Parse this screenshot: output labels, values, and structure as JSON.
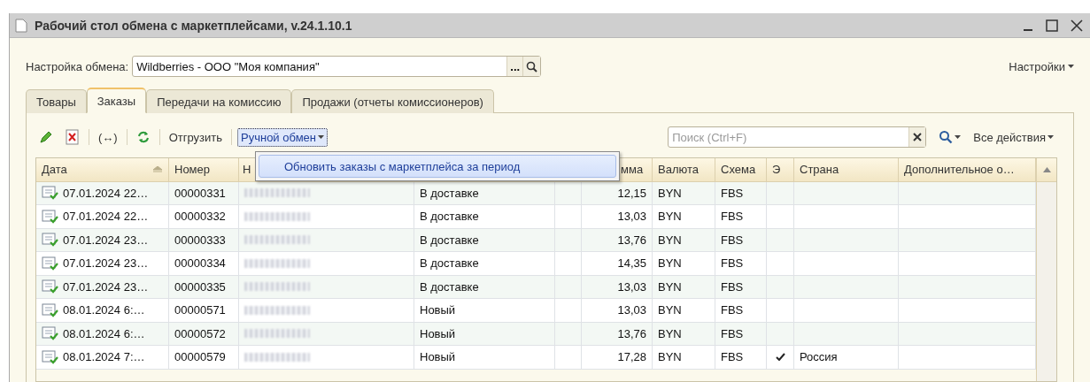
{
  "window": {
    "title": "Рабочий стол обмена с маркетплейсами, v.24.1.10.1"
  },
  "settings_row": {
    "label": "Настройка обмена:",
    "value": "Wildberries - ООО \"Моя компания\"",
    "choose_button": "...",
    "menu": "Настройки"
  },
  "tabs": [
    {
      "label": "Товары",
      "selected": false
    },
    {
      "label": "Заказы",
      "selected": true
    },
    {
      "label": "Передачи на комиссию",
      "selected": false
    },
    {
      "label": "Продажи (отчеты комиссионеров)",
      "selected": false
    }
  ],
  "toolbar": {
    "expand_button": "(↔)",
    "ship_button": "Отгрузить",
    "manual_exchange": {
      "label": "Ручной обмен",
      "expanded": true,
      "items": [
        {
          "label": "Обновить заказы с маркетплейса за период",
          "selected": true
        }
      ]
    },
    "search": {
      "placeholder": "Поиск (Ctrl+F)"
    },
    "all_actions": "Все действия"
  },
  "table": {
    "columns": [
      {
        "label": "Дата",
        "sorted": true
      },
      {
        "label": "Номер",
        "sorted": false
      },
      {
        "label": "Н"
      },
      {},
      {},
      {
        "label": "мма"
      },
      {
        "label": "Валюта",
        "sorted": false
      },
      {
        "label": "Схема",
        "sorted": false
      },
      {
        "label": "Э",
        "sorted": false
      },
      {
        "label": "Страна",
        "sorted": false
      },
      {
        "label": "Дополнительное о…",
        "sorted": false
      }
    ],
    "rows": [
      {
        "date": "07.01.2024 22…",
        "number": "00000331",
        "status": "В доставке",
        "sum": "12,15",
        "currency": "BYN",
        "scheme": "FBS",
        "exported": false
      },
      {
        "date": "07.01.2024 22…",
        "number": "00000332",
        "status": "В доставке",
        "sum": "13,03",
        "currency": "BYN",
        "scheme": "FBS",
        "exported": false
      },
      {
        "date": "07.01.2024 23…",
        "number": "00000333",
        "status": "В доставке",
        "sum": "13,76",
        "currency": "BYN",
        "scheme": "FBS",
        "exported": false
      },
      {
        "date": "07.01.2024 23…",
        "number": "00000334",
        "status": "В доставке",
        "sum": "14,35",
        "currency": "BYN",
        "scheme": "FBS",
        "exported": false
      },
      {
        "date": "07.01.2024 23…",
        "number": "00000335",
        "status": "В доставке",
        "sum": "13,03",
        "currency": "BYN",
        "scheme": "FBS",
        "exported": false
      },
      {
        "date": "08.01.2024 6:…",
        "number": "00000571",
        "status": "Новый",
        "sum": "13,03",
        "currency": "BYN",
        "scheme": "FBS",
        "exported": false
      },
      {
        "date": "08.01.2024 6:…",
        "number": "00000572",
        "status": "Новый",
        "sum": "13,76",
        "currency": "BYN",
        "scheme": "FBS",
        "exported": false
      },
      {
        "date": "08.01.2024 7:…",
        "number": "00000579",
        "status": "Новый",
        "sum": "17,28",
        "currency": "BYN",
        "scheme": "FBS",
        "exported": true,
        "country": "Россия"
      }
    ]
  }
}
